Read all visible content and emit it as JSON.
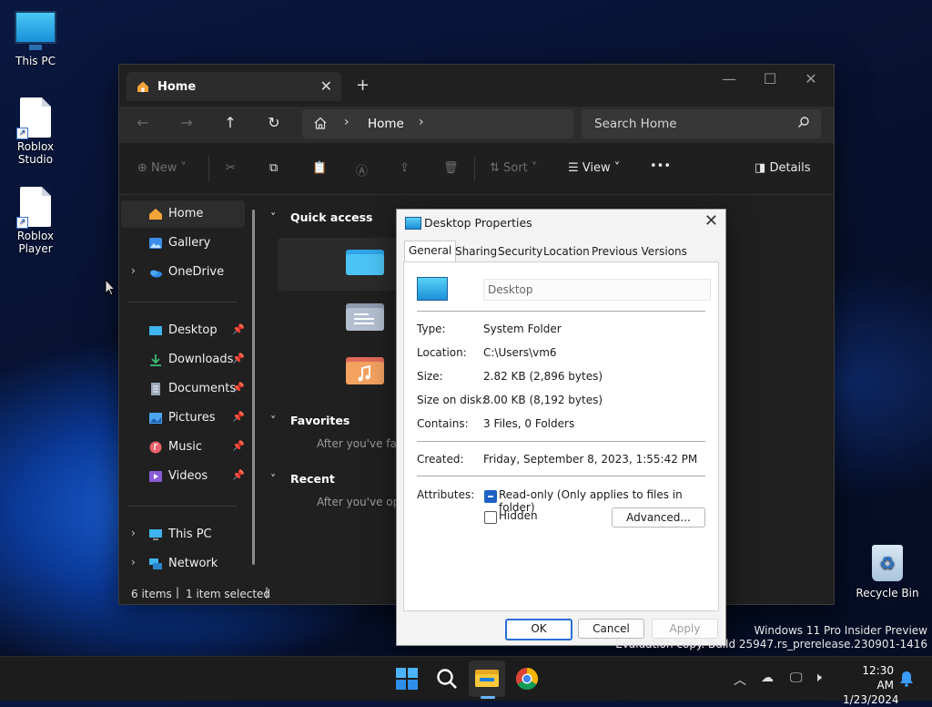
{
  "desktop": {
    "icons": [
      {
        "label": "This PC"
      },
      {
        "label": "Roblox Studio"
      },
      {
        "label": "Roblox Player"
      },
      {
        "label": "Recycle Bin"
      }
    ],
    "watermark": {
      "line1": "Windows 11 Pro Insider Preview",
      "line2": "Evaluation copy. Build 25947.rs_prerelease.230901-1416"
    }
  },
  "explorer": {
    "tab_title": "Home",
    "new_tab": "+",
    "address": {
      "crumb": "Home"
    },
    "search": {
      "placeholder": "Search Home"
    },
    "toolbar": {
      "new_label": "New",
      "sort_label": "Sort",
      "view_label": "View",
      "more_label": "•••",
      "details_label": "Details"
    },
    "sidebar": {
      "items": [
        {
          "label": "Home"
        },
        {
          "label": "Gallery"
        },
        {
          "label": "OneDrive"
        },
        {
          "label": "Desktop"
        },
        {
          "label": "Downloads"
        },
        {
          "label": "Documents"
        },
        {
          "label": "Pictures"
        },
        {
          "label": "Music"
        },
        {
          "label": "Videos"
        },
        {
          "label": "This PC"
        },
        {
          "label": "Network"
        }
      ]
    },
    "content": {
      "quick_access": "Quick access",
      "favorites": "Favorites",
      "favorites_hint": "After you've favo",
      "recent": "Recent",
      "recent_hint": "After you've ope"
    },
    "status": {
      "items": "6 items",
      "selected": "1 item selected"
    }
  },
  "dialog": {
    "title": "Desktop Properties",
    "tabs": [
      "General",
      "Sharing",
      "Security",
      "Location",
      "Previous Versions"
    ],
    "name_value": "Desktop",
    "props": [
      {
        "label": "Type:",
        "value": "System Folder"
      },
      {
        "label": "Location:",
        "value": "C:\\Users\\vm6"
      },
      {
        "label": "Size:",
        "value": "2.82 KB (2,896 bytes)"
      },
      {
        "label": "Size on disk:",
        "value": "8.00 KB (8,192 bytes)"
      },
      {
        "label": "Contains:",
        "value": "3 Files, 0 Folders"
      }
    ],
    "created": {
      "label": "Created:",
      "value": "Friday, September 8, 2023, 1:55:42 PM"
    },
    "attributes": {
      "label": "Attributes:",
      "readonly": "Read-only (Only applies to files in folder)",
      "hidden": "Hidden",
      "advanced": "Advanced..."
    },
    "buttons": {
      "ok": "OK",
      "cancel": "Cancel",
      "apply": "Apply"
    }
  },
  "taskbar": {
    "time": "12:30 AM",
    "date": "1/23/2024"
  }
}
